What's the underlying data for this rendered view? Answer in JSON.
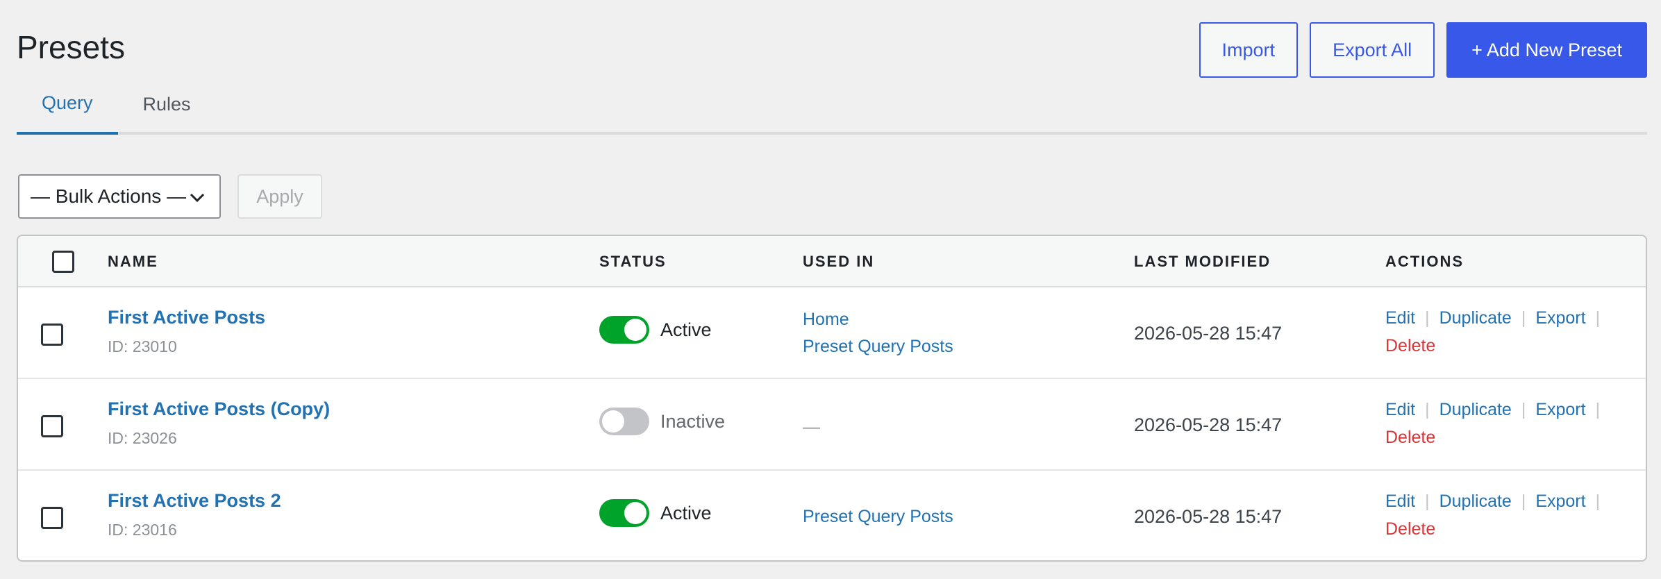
{
  "page": {
    "title": "Presets",
    "import_label": "Import",
    "export_all_label": "Export All",
    "add_new_label": "+ Add New Preset"
  },
  "tabs": [
    {
      "label": "Query",
      "active": true
    },
    {
      "label": "Rules",
      "active": false
    }
  ],
  "bulk": {
    "selected": "— Bulk Actions —",
    "apply_label": "Apply"
  },
  "table": {
    "columns": [
      "NAME",
      "STATUS",
      "USED IN",
      "LAST MODIFIED",
      "ACTIONS"
    ],
    "rows": [
      {
        "name": "First Active Posts",
        "id": "ID: 23010",
        "status": "Active",
        "active": true,
        "used_in": [
          "Home",
          "Preset Query Posts"
        ],
        "modified": "2026-05-28 15:47",
        "actions": [
          "Edit",
          "Duplicate",
          "Export",
          "Delete"
        ]
      },
      {
        "name": "First Active Posts (Copy)",
        "id": "ID: 23026",
        "status": "Inactive",
        "active": false,
        "used_in_empty": "—",
        "modified": "2026-05-28 15:47",
        "actions": [
          "Edit",
          "Duplicate",
          "Export",
          "Delete"
        ]
      },
      {
        "name": "First Active Posts 2",
        "id": "ID: 23016",
        "status": "Active",
        "active": true,
        "used_in": [
          "Preset Query Posts"
        ],
        "modified": "2026-05-28 15:47",
        "actions": [
          "Edit",
          "Duplicate",
          "Export",
          "Delete"
        ]
      }
    ]
  },
  "colors": {
    "primary": "#3858e9",
    "link": "#2271b1",
    "toggle_on": "#00a32a",
    "toggle_off": "#c3c4c7",
    "delete": "#d63638"
  },
  "icons": {
    "select_chevron": "chevron-down-icon"
  }
}
